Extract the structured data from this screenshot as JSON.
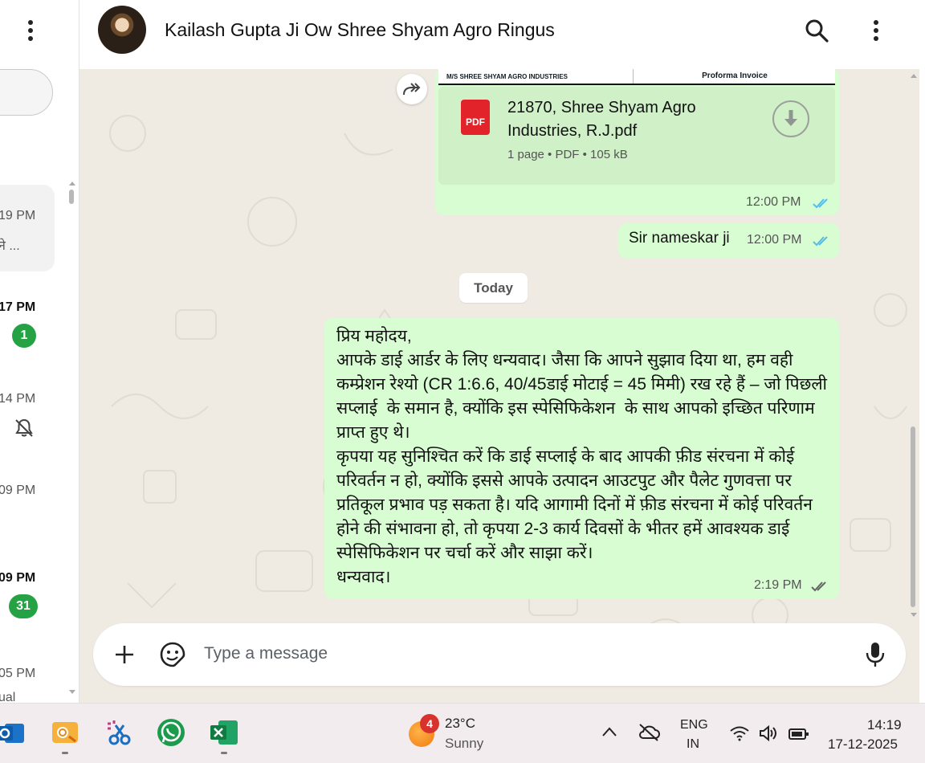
{
  "left_panel": {
    "items": [
      {
        "time": "19 PM",
        "preview": "ने ..."
      },
      {
        "time": "17 PM",
        "badge": "1"
      },
      {
        "time": "14 PM"
      },
      {
        "time": "09 PM"
      },
      {
        "time": "09 PM",
        "badge": "31"
      },
      {
        "time": "05 PM",
        "preview": "ual"
      }
    ]
  },
  "header": {
    "title": "Kailash Gupta Ji Ow Shree Shyam Agro Ringus"
  },
  "messages": {
    "doc": {
      "thumb_left": "M/S SHREE SHYAM AGRO INDUSTRIES",
      "thumb_right": "Proforma Invoice",
      "icon_label": "PDF",
      "file_name": "21870, Shree Shyam Agro Industries, R.J.pdf",
      "meta": "1 page • PDF • 105 kB",
      "time": "12:00 PM"
    },
    "greet": {
      "text": "Sir nameskar ji",
      "time": "12:00 PM"
    },
    "date_divider": "Today",
    "long": {
      "text": "प्रिय महोदय,\nआपके डाई आर्डर के लिए धन्यवाद। जैसा कि आपने सुझाव दिया था, हम वही कम्प्रेशन रेश्यो (CR 1:6.6, 40/45डाई मोटाई = 45 मिमी) रख रहे हैं – जो पिछली सप्लाई  के समान है, क्योंकि इस स्पेसिफिकेशन  के साथ आपको इच्छित परिणाम प्राप्त हुए थे।\nकृपया यह सुनिश्चित करें कि डाई सप्लाई के बाद आपकी फ़ीड संरचना में कोई परिवर्तन न हो, क्योंकि इससे आपके उत्पादन आउटपुट और पैलेट गुणवत्ता पर प्रतिकूल प्रभाव पड़ सकता है। यदि आगामी दिनों में फ़ीड संरचना में कोई परिवर्तन होने की संभावना हो, तो कृपया 2-3 कार्य दिवसों के भीतर हमें आवश्यक डाई स्पेसिफिकेशन पर चर्चा करें और साझा करें।\nधन्यवाद।",
      "time": "2:19 PM"
    }
  },
  "composer": {
    "placeholder": "Type a message"
  },
  "taskbar": {
    "weather_badge": "4",
    "temp": "23°C",
    "condition": "Sunny",
    "lang": "ENG",
    "region": "IN",
    "time": "14:19",
    "date": "17-12-2025"
  },
  "colors": {
    "bubble": "#d9fdd3",
    "badge": "#25a244",
    "tick": "#53bdeb",
    "chat_bg": "#efeae2"
  }
}
